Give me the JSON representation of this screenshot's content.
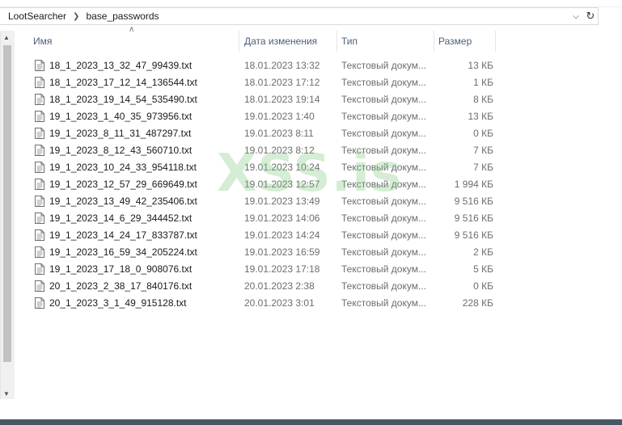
{
  "breadcrumb": {
    "items": [
      "LootSearcher",
      "base_passwords"
    ]
  },
  "columns": {
    "name": "Имя",
    "date": "Дата изменения",
    "type": "Тип",
    "size": "Размер"
  },
  "files": [
    {
      "name": "18_1_2023_13_32_47_99439.txt",
      "date": "18.01.2023 13:32",
      "type": "Текстовый докум...",
      "size": "13 КБ"
    },
    {
      "name": "18_1_2023_17_12_14_136544.txt",
      "date": "18.01.2023 17:12",
      "type": "Текстовый докум...",
      "size": "1 КБ"
    },
    {
      "name": "18_1_2023_19_14_54_535490.txt",
      "date": "18.01.2023 19:14",
      "type": "Текстовый докум...",
      "size": "8 КБ"
    },
    {
      "name": "19_1_2023_1_40_35_973956.txt",
      "date": "19.01.2023 1:40",
      "type": "Текстовый докум...",
      "size": "13 КБ"
    },
    {
      "name": "19_1_2023_8_11_31_487297.txt",
      "date": "19.01.2023 8:11",
      "type": "Текстовый докум...",
      "size": "0 КБ"
    },
    {
      "name": "19_1_2023_8_12_43_560710.txt",
      "date": "19.01.2023 8:12",
      "type": "Текстовый докум...",
      "size": "7 КБ"
    },
    {
      "name": "19_1_2023_10_24_33_954118.txt",
      "date": "19.01.2023 10:24",
      "type": "Текстовый докум...",
      "size": "7 КБ"
    },
    {
      "name": "19_1_2023_12_57_29_669649.txt",
      "date": "19.01.2023 12:57",
      "type": "Текстовый докум...",
      "size": "1 994 КБ"
    },
    {
      "name": "19_1_2023_13_49_42_235406.txt",
      "date": "19.01.2023 13:49",
      "type": "Текстовый докум...",
      "size": "9 516 КБ"
    },
    {
      "name": "19_1_2023_14_6_29_344452.txt",
      "date": "19.01.2023 14:06",
      "type": "Текстовый докум...",
      "size": "9 516 КБ"
    },
    {
      "name": "19_1_2023_14_24_17_833787.txt",
      "date": "19.01.2023 14:24",
      "type": "Текстовый докум...",
      "size": "9 516 КБ"
    },
    {
      "name": "19_1_2023_16_59_34_205224.txt",
      "date": "19.01.2023 16:59",
      "type": "Текстовый докум...",
      "size": "2 КБ"
    },
    {
      "name": "19_1_2023_17_18_0_908076.txt",
      "date": "19.01.2023 17:18",
      "type": "Текстовый докум...",
      "size": "5 КБ"
    },
    {
      "name": "20_1_2023_2_38_17_840176.txt",
      "date": "20.01.2023 2:38",
      "type": "Текстовый докум...",
      "size": "0 КБ"
    },
    {
      "name": "20_1_2023_3_1_49_915128.txt",
      "date": "20.01.2023 3:01",
      "type": "Текстовый докум...",
      "size": "228 КБ"
    }
  ],
  "watermark": "XSS.is",
  "icons": {
    "file": "text-file-icon",
    "dropdown": "chevron-down-icon",
    "refresh": "refresh-icon",
    "breadcrumb_separator": "chevron-right-icon",
    "sort": "sort-ascending-icon"
  },
  "colors": {
    "header_text": "#4c607a",
    "secondary_text": "#6d6d6d",
    "watermark": "#78c878",
    "taskbar": "#4a5663"
  }
}
